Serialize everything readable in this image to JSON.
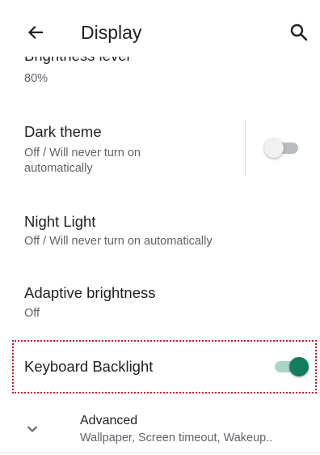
{
  "appbar": {
    "title": "Display",
    "back_icon": "arrow-back-icon",
    "search_icon": "search-icon"
  },
  "settings": {
    "brightness": {
      "title": "Brightness level",
      "summary": "80%"
    },
    "dark_theme": {
      "title": "Dark theme",
      "summary_line1": "Off / Will never turn on",
      "summary_line2": "automatically",
      "enabled": false
    },
    "night_light": {
      "title": "Night Light",
      "summary": "Off / Will never turn on automatically"
    },
    "adaptive_brightness": {
      "title": "Adaptive brightness",
      "summary": "Off"
    },
    "keyboard_backlight": {
      "title": "Keyboard Backlight",
      "enabled": true
    },
    "advanced": {
      "title": "Advanced",
      "summary": "Wallpaper, Screen timeout, Wakeup..",
      "icon": "chevron-down-icon"
    }
  },
  "colors": {
    "accent": "#127c5d",
    "accent_track": "#a8d5c5",
    "highlight_border": "#c8102e"
  }
}
